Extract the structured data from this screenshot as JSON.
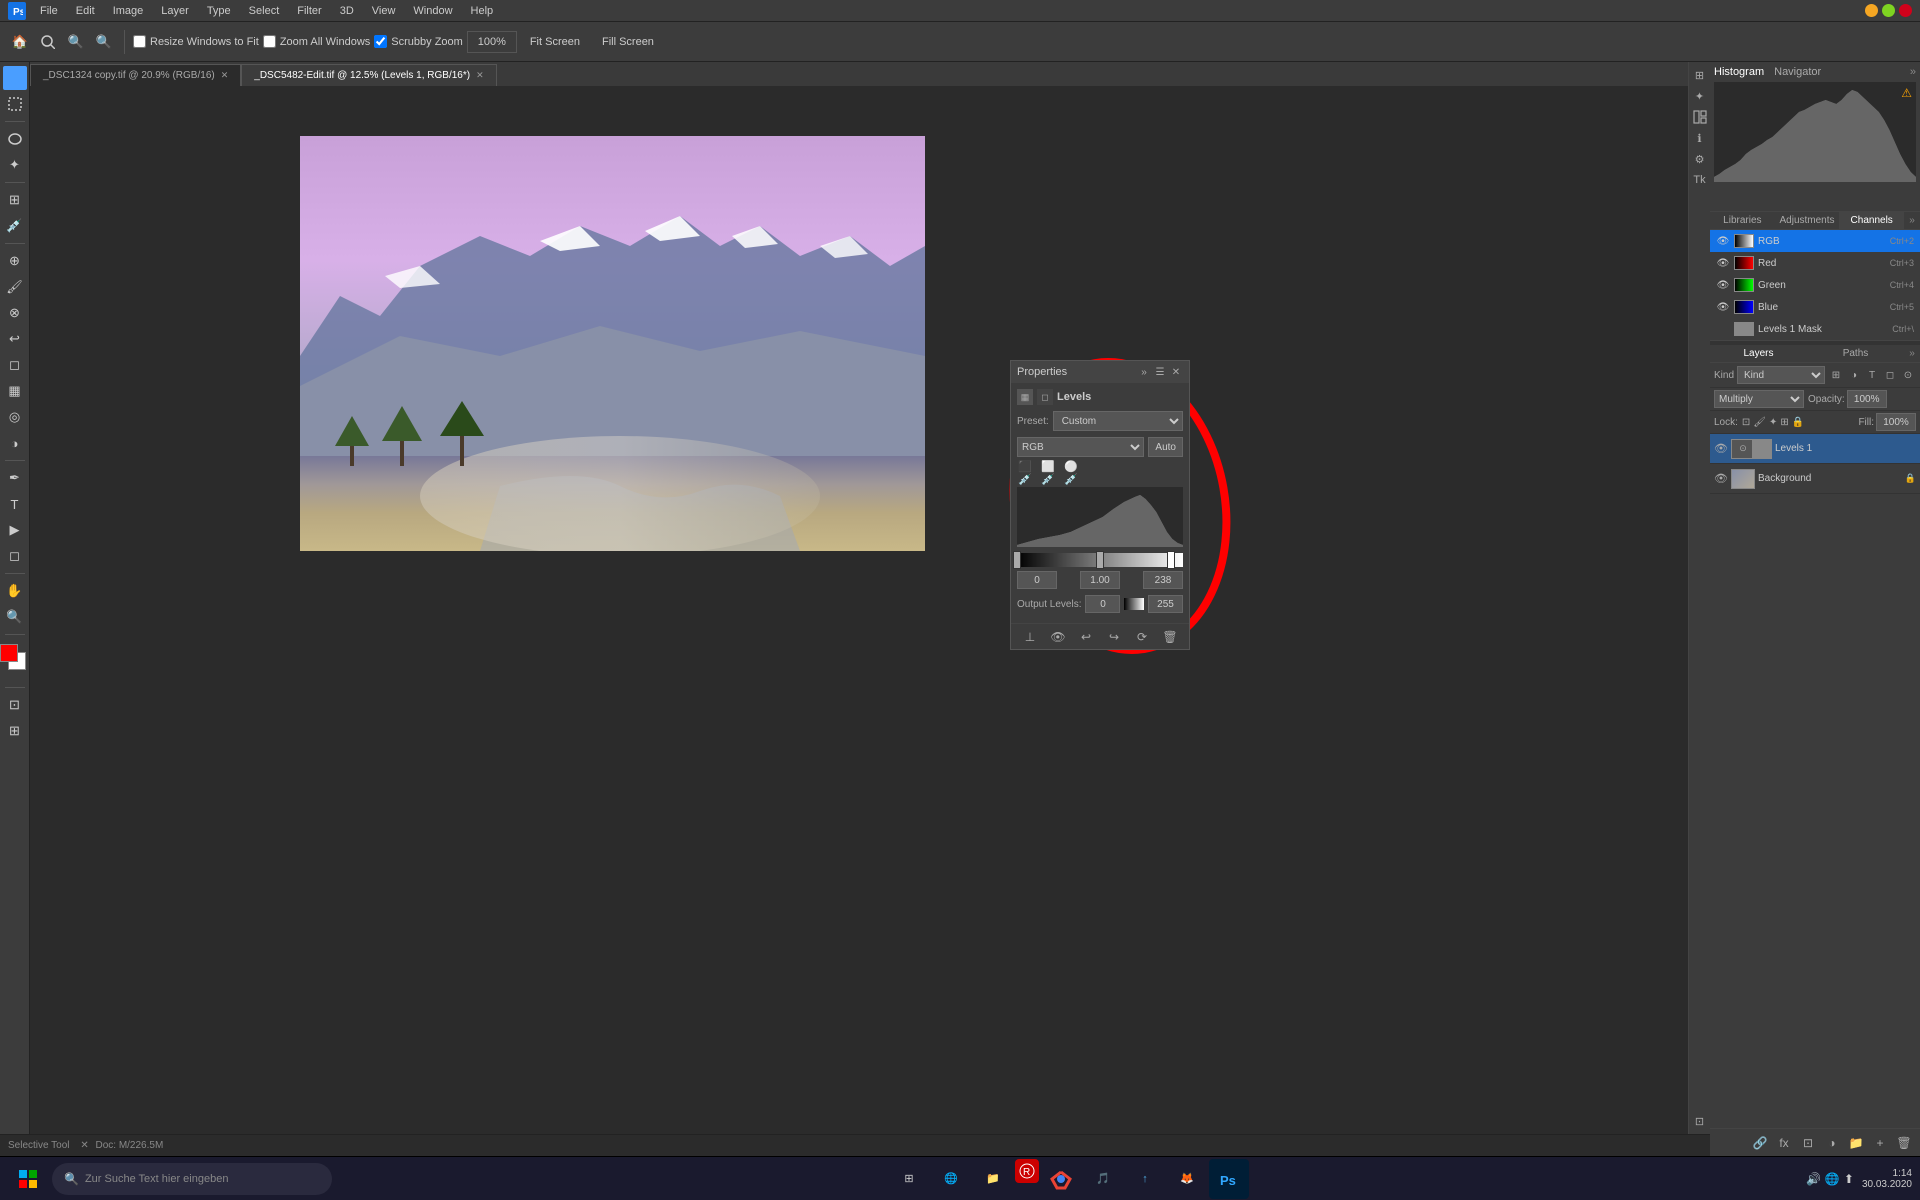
{
  "app": {
    "title": "Adobe Photoshop",
    "menu_items": [
      "File",
      "Edit",
      "Image",
      "Layer",
      "Type",
      "Select",
      "Filter",
      "3D",
      "View",
      "Window",
      "Help"
    ]
  },
  "toolbar": {
    "resize_windows": "Resize Windows to Fit",
    "zoom_all_windows": "Zoom All Windows",
    "scrubby_zoom": "Scrubby Zoom",
    "zoom_percent": "100%",
    "fit_screen": "Fit Screen",
    "fill_screen": "Fill Screen"
  },
  "tabs": [
    {
      "label": "_DSC1324 copy.tif @ 20.9% (RGB/16)",
      "active": false,
      "closeable": true
    },
    {
      "label": "_DSC5482-Edit.tif @ 12.5% (Levels 1, RGB/16*)",
      "active": true,
      "closeable": true
    }
  ],
  "histogram": {
    "title": "Histogram",
    "navigator": "Navigator",
    "warning": "⚠"
  },
  "panels": {
    "libraries": "Libraries",
    "adjustments": "Adjustments",
    "channels": "Channels"
  },
  "channel_rows": [
    {
      "name": "RGB",
      "shortcut": "Ctrl+2",
      "selected": true
    },
    {
      "name": "Red",
      "shortcut": "Ctrl+3",
      "selected": false
    },
    {
      "name": "Green",
      "shortcut": "Ctrl+4",
      "selected": false
    },
    {
      "name": "Blue",
      "shortcut": "Ctrl+5",
      "selected": false
    },
    {
      "name": "Levels 1 Mask",
      "shortcut": "Ctrl+\\",
      "selected": false
    }
  ],
  "properties": {
    "title": "Properties",
    "adjustment_type": "Levels",
    "preset_label": "Preset:",
    "preset_value": "Custom",
    "channel": "RGB",
    "auto_btn": "Auto",
    "input_min": "0",
    "input_mid": "1.00",
    "input_max": "238",
    "output_label": "Output Levels:",
    "output_min": "0",
    "output_max": "255"
  },
  "layers": {
    "tabs": [
      "Layers",
      "Paths"
    ],
    "filter_label": "Kind",
    "blend_mode": "Multiply",
    "opacity_label": "Opacity:",
    "opacity_value": "100%",
    "fill_label": "Fill:",
    "fill_value": "100%",
    "lock_label": "Lock:",
    "items": [
      {
        "name": "Levels 1",
        "type": "adjustment",
        "visible": true,
        "has_mask": true
      },
      {
        "name": "Background",
        "type": "image",
        "visible": true,
        "locked": true
      }
    ]
  },
  "status_bar": {
    "tool": "Selective Tool",
    "doc_info": "Doc: M/226.5M"
  },
  "taskbar": {
    "search_placeholder": "Zur Suche Text hier eingeben",
    "time": "1:14",
    "date": "30.03.2020",
    "system_icons": [
      "🔊",
      "🌐",
      "⬆"
    ]
  }
}
